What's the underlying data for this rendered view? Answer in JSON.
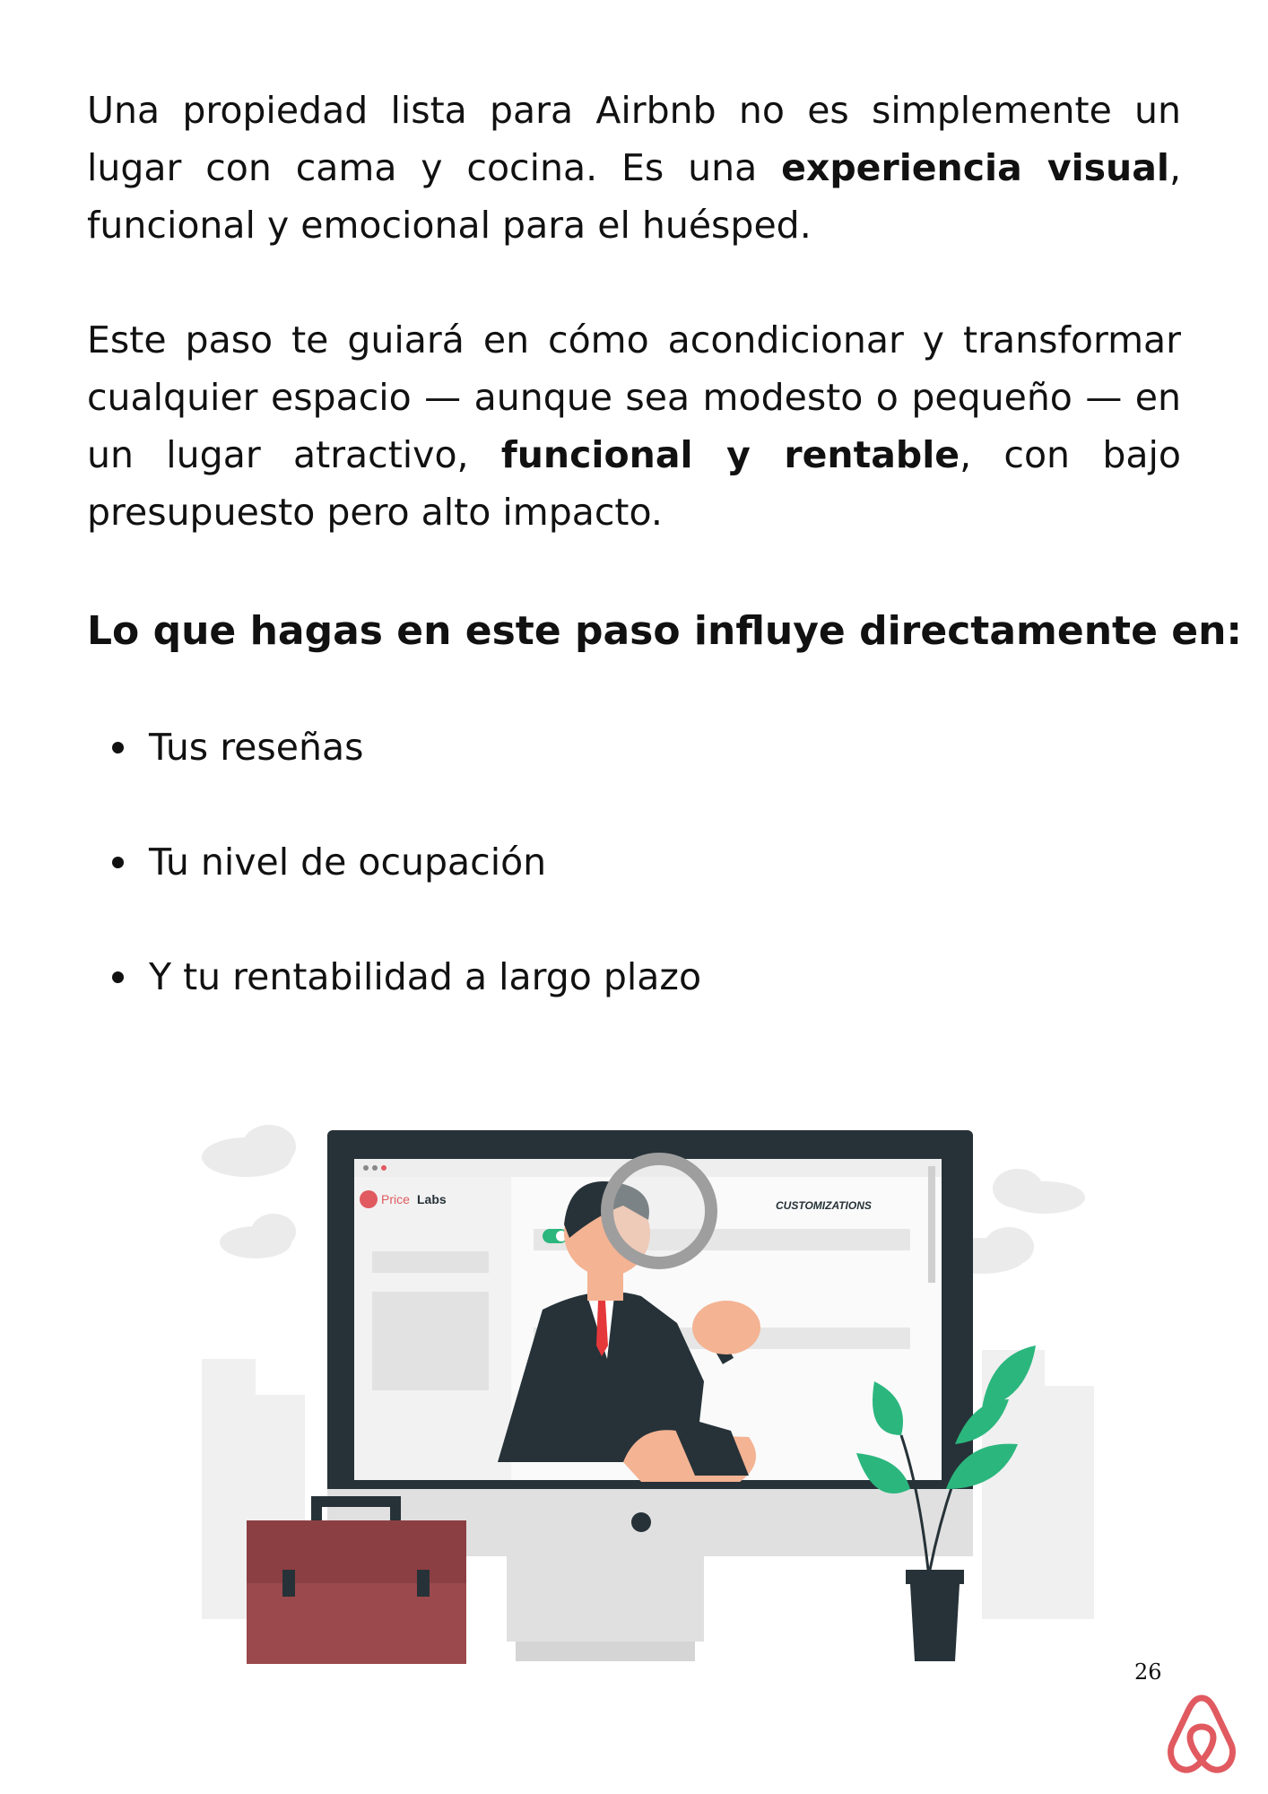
{
  "paragraph1": {
    "part1": "Una propiedad lista para Airbnb no es simplemente un lugar con cama y cocina. Es una ",
    "bold": "experiencia visual",
    "part2": ", funcional y emocional para el huésped."
  },
  "paragraph2": {
    "part1": "Este paso te guiará en cómo acondicionar y transformar cualquier espacio — aunque sea modesto o pequeño — en un lugar atractivo, ",
    "bold": "funcional y rentable",
    "part2": ", con bajo presupuesto pero alto impacto."
  },
  "heading": "Lo que hagas en este paso influye directamente en:",
  "bullets": [
    "Tus reseñas",
    "Tu nivel de ocupación",
    "Y tu rentabilidad a largo plazo"
  ],
  "illustration": {
    "brand_price": "Price",
    "brand_labs": "Labs",
    "screen_label": "CUSTOMIZATIONS"
  },
  "page_number": "26",
  "colors": {
    "airbnb": "#e05a60",
    "plant": "#2bb67d",
    "briefcase": "#9b494c",
    "monitor": "#263238"
  }
}
